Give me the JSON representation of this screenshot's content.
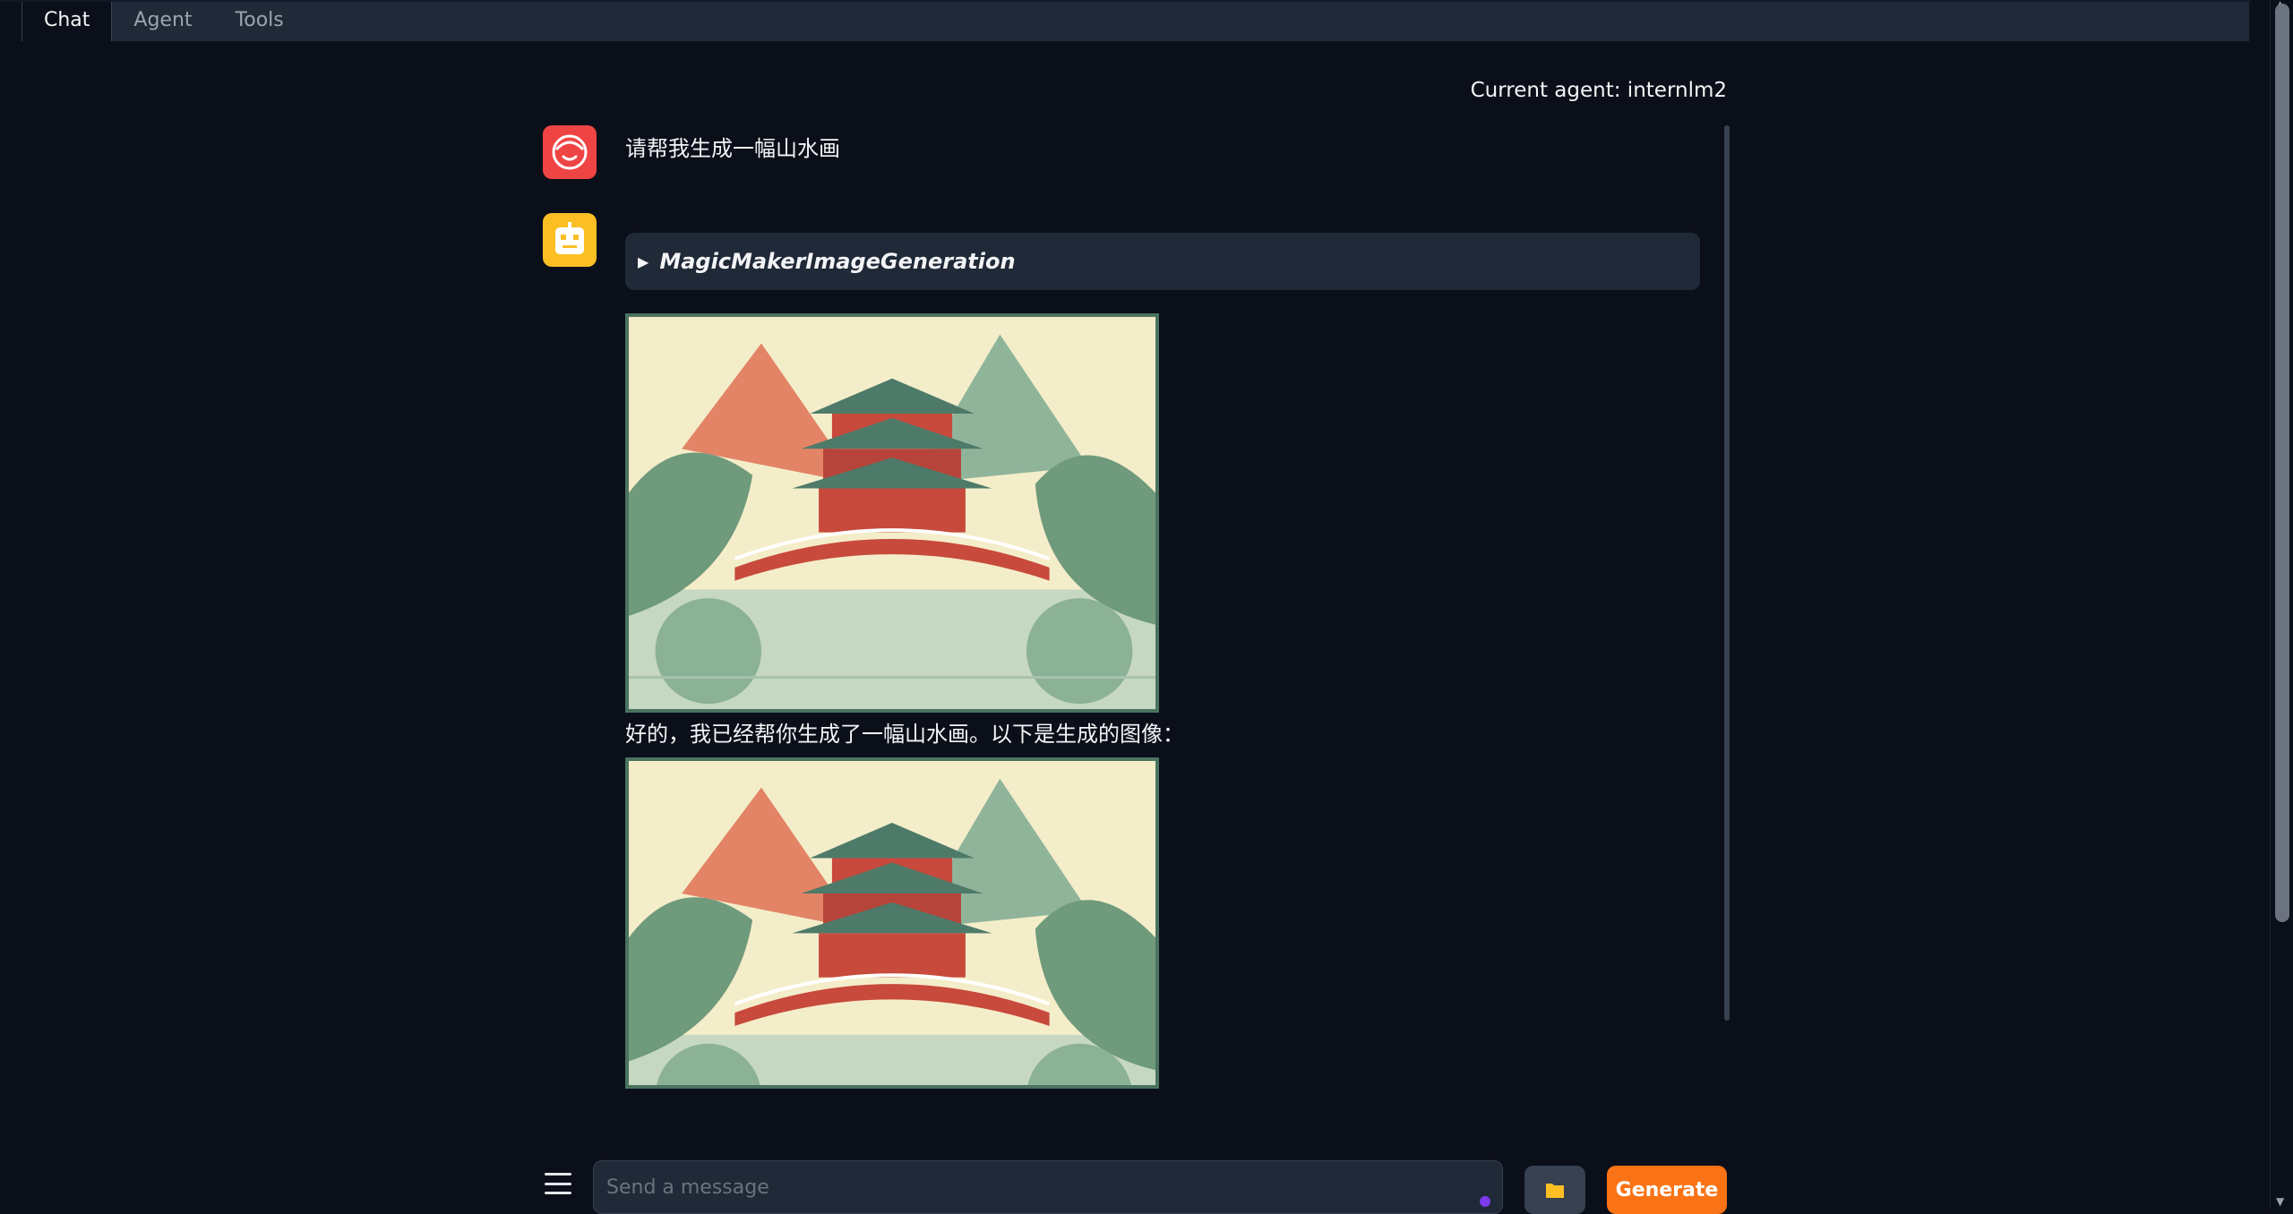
{
  "tabs": [
    {
      "label": "Chat",
      "active": true
    },
    {
      "label": "Agent",
      "active": false
    },
    {
      "label": "Tools",
      "active": false
    }
  ],
  "agent": {
    "label": "Current agent: internlm2"
  },
  "chat": {
    "user_message": "请帮我生成一幅山水画",
    "tool_call": "MagicMakerImageGeneration",
    "bot_message": "好的，我已经帮你生成了一幅山水画。以下是生成的图像：",
    "images": [
      "landscape-pavilion-bridge",
      "landscape-pavilion-bridge"
    ]
  },
  "input": {
    "placeholder": "Send a message",
    "value": ""
  },
  "buttons": {
    "upload_icon": "folder-icon",
    "generate_label": "Generate"
  },
  "colors": {
    "background": "#0b0f19",
    "panel": "#1f2937",
    "accent": "#f97316",
    "user_avatar": "#ef4444",
    "bot_avatar": "#fbbf24"
  }
}
